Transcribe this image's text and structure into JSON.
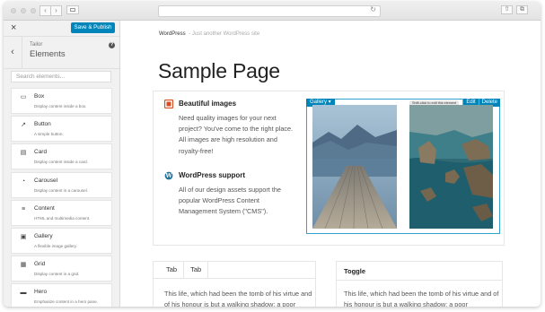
{
  "toolbar": {
    "close_label": "×",
    "save_label": "Save & Publish"
  },
  "panel": {
    "crumb": "Tailor",
    "title": "Elements",
    "help": "?",
    "back": "‹",
    "search_placeholder": "Search elements..."
  },
  "elements": [
    {
      "name": "Box",
      "desc": "Display content inside a box.",
      "icon": "▭"
    },
    {
      "name": "Button",
      "desc": "A simple button.",
      "icon": "↗"
    },
    {
      "name": "Card",
      "desc": "Display content inside a card.",
      "icon": "▤"
    },
    {
      "name": "Carousel",
      "desc": "Display content in a carousel.",
      "icon": "◔"
    },
    {
      "name": "Content",
      "desc": "HTML and multimedia content.",
      "icon": "≡"
    },
    {
      "name": "Gallery",
      "desc": "A flexible image gallery.",
      "icon": "▣"
    },
    {
      "name": "Grid",
      "desc": "Display content in a grid.",
      "icon": "▦"
    },
    {
      "name": "Hero",
      "desc": "Emphasize content in a hero pane.",
      "icon": "▬"
    }
  ],
  "site": {
    "name": "WordPress",
    "tagline": "- Just another WordPress site"
  },
  "page": {
    "title": "Sample Page"
  },
  "features": [
    {
      "title": "Beautiful images",
      "text": "Need quality images for your next project? You've come to the right place. All images are high resolution and royalty-free!",
      "icon": "image-icon"
    },
    {
      "title": "WordPress support",
      "text": "All of our design assets support the popular WordPress Content Management System (\"CMS\").",
      "icon": "wordpress-icon"
    }
  ],
  "gallery": {
    "label": "Gallery ▾",
    "tooltip": "Shift-click to edit this element",
    "edit": "Edit",
    "delete": "Delete"
  },
  "tabs": {
    "labels": [
      "Tab",
      "Tab"
    ],
    "text": "This life, which had been the tomb of his virtue and of his honour is but a walking shadow; a poor"
  },
  "toggle": {
    "title": "Toggle",
    "text": "This life, which had been the tomb of his virtue and of his honour is but a walking shadow; a poor"
  },
  "colors": {
    "accent": "#0085ba",
    "highlight": "#2ea2cc",
    "image_icon": "#d54e21",
    "wp_icon": "#21759b"
  }
}
